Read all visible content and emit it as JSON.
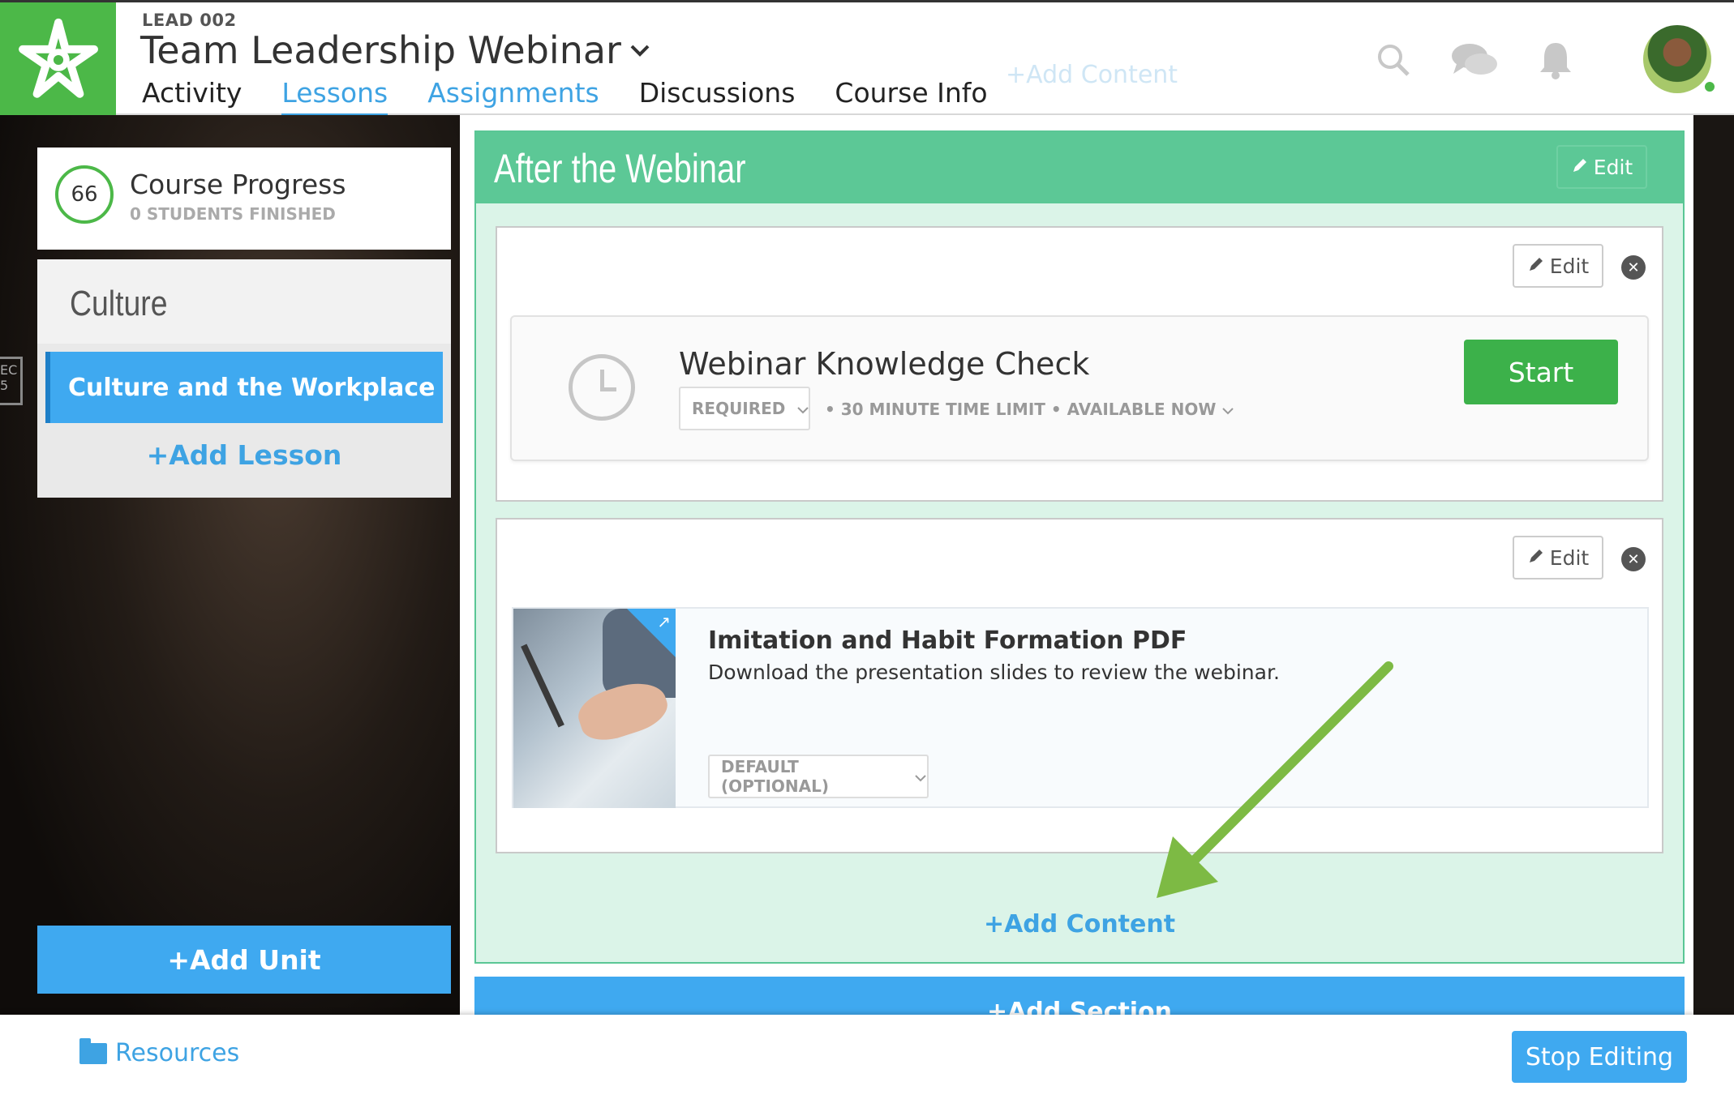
{
  "header": {
    "course_code": "LEAD 002",
    "course_title": "Team Leadership Webinar",
    "tabs": [
      {
        "label": "Activity"
      },
      {
        "label": "Lessons"
      },
      {
        "label": "Assignments"
      },
      {
        "label": "Discussions"
      },
      {
        "label": "Course Info"
      }
    ],
    "active_tab": "Lessons",
    "ghost_add_content": "+Add Content",
    "icons": [
      "search-icon",
      "chat-icon",
      "bell-icon"
    ],
    "logo": "star-logo",
    "brand_color": "#4cb848"
  },
  "sidebar": {
    "progress": {
      "value": "66",
      "title": "Course Progress",
      "subtitle": "0 STUDENTS FINISHED"
    },
    "unit": {
      "title": "Culture",
      "lessons": [
        {
          "label": "Culture and the Workplace",
          "selected": true
        }
      ],
      "add_lesson_label": "+Add Lesson"
    },
    "add_unit_label": "+Add Unit",
    "side_tag": "EC\n5"
  },
  "section": {
    "title": "After the Webinar",
    "edit_label": "Edit",
    "items": [
      {
        "edit_label": "Edit",
        "title": "Webinar Knowledge Check",
        "requirement": "REQUIRED",
        "meta": "• 30 MINUTE TIME LIMIT  •  AVAILABLE NOW",
        "start_label": "Start"
      },
      {
        "edit_label": "Edit",
        "title": "Imitation and Habit Formation PDF",
        "description": "Download the presentation slides to review the webinar.",
        "requirement": "DEFAULT (OPTIONAL)"
      }
    ],
    "add_content_label": "+Add Content"
  },
  "add_section_label": "+Add Section",
  "footer": {
    "resources_label": "Resources",
    "stop_editing_label": "Stop Editing"
  },
  "colors": {
    "accent_blue": "#3fa9f0",
    "section_green": "#5cc896",
    "start_green": "#3cb14a",
    "annotation_arrow": "#7dba44"
  }
}
